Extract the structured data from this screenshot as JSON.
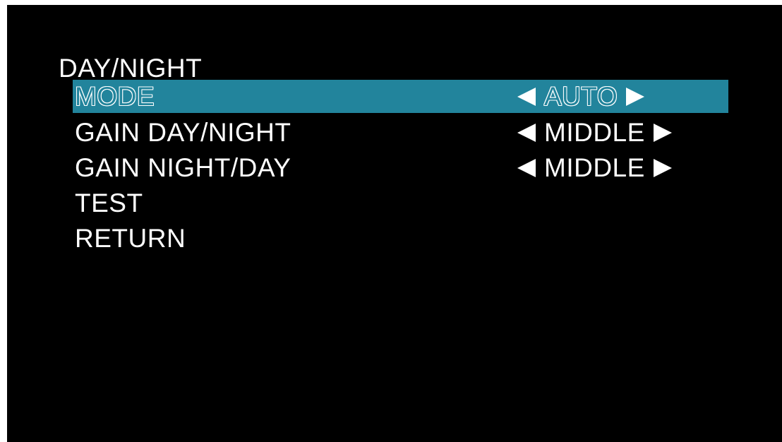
{
  "menu": {
    "title": "DAY/NIGHT",
    "items": [
      {
        "label": "MODE",
        "value": "AUTO",
        "selected": true
      },
      {
        "label": "GAIN DAY/NIGHT",
        "value": "MIDDLE"
      },
      {
        "label": "GAIN NIGHT/DAY",
        "value": "MIDDLE"
      },
      {
        "label": "TEST"
      },
      {
        "label": "RETURN"
      }
    ]
  },
  "colors": {
    "background": "#000000",
    "highlight": "#22849c",
    "text": "#ffffff"
  },
  "icons": {
    "decrease": "triangle-left-icon",
    "increase": "triangle-right-icon"
  }
}
